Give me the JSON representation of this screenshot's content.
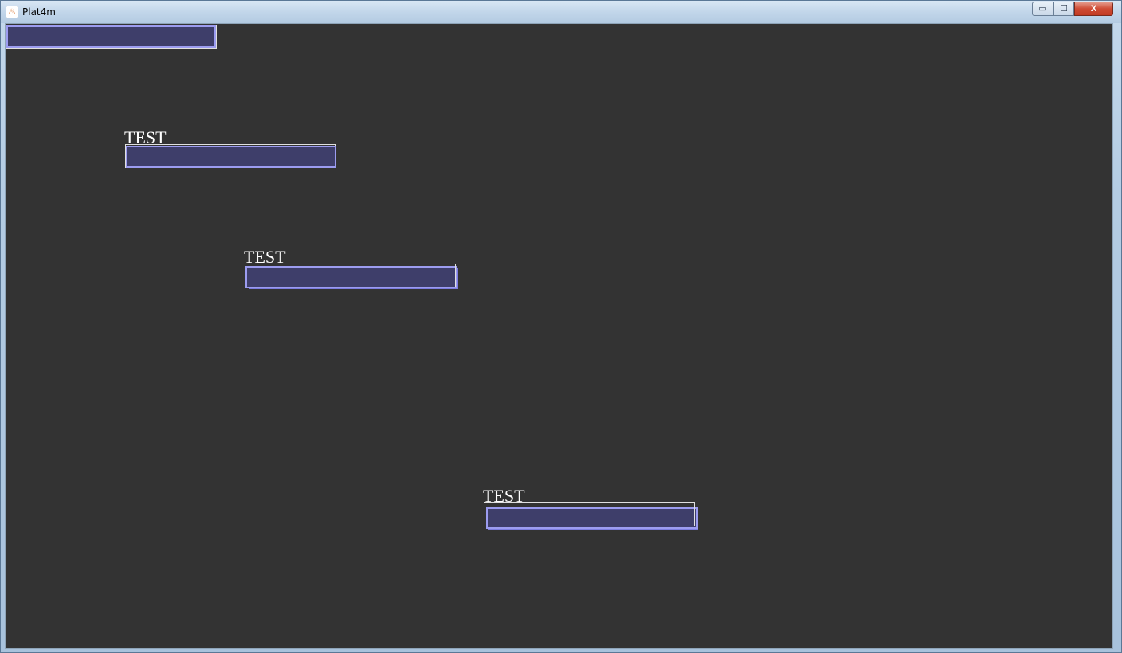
{
  "window": {
    "title": "Plat4m",
    "controls": {
      "minimize": "▭",
      "maximize": "☐",
      "close": "X"
    }
  },
  "canvas": {
    "labels": [
      "TEST",
      "TEST",
      "TEST"
    ]
  },
  "colors": {
    "background": "#333333",
    "bar_fill": "#3e3e6a",
    "bar_border": "#9c9cf0",
    "outline": "#e0e0e0",
    "text": "#ffffff"
  }
}
